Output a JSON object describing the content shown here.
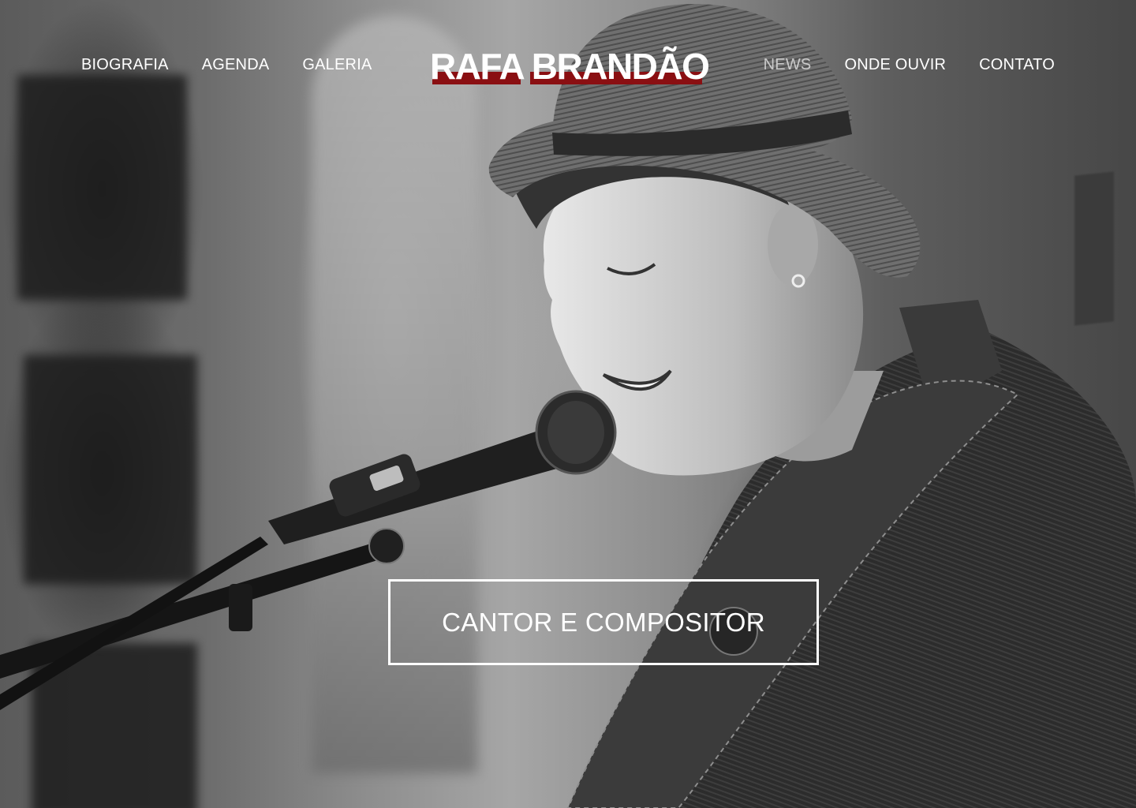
{
  "site": {
    "logo_text": "RAFA BRANDÃO",
    "brand_color": "#8a0f12"
  },
  "nav": {
    "left": [
      {
        "label": "BIOGRAFIA"
      },
      {
        "label": "AGENDA"
      },
      {
        "label": "GALERIA"
      }
    ],
    "right": [
      {
        "label": "NEWS"
      },
      {
        "label": "ONDE OUVIR"
      },
      {
        "label": "CONTATO"
      }
    ]
  },
  "hero": {
    "cta_label": "CANTOR E COMPOSITOR"
  }
}
